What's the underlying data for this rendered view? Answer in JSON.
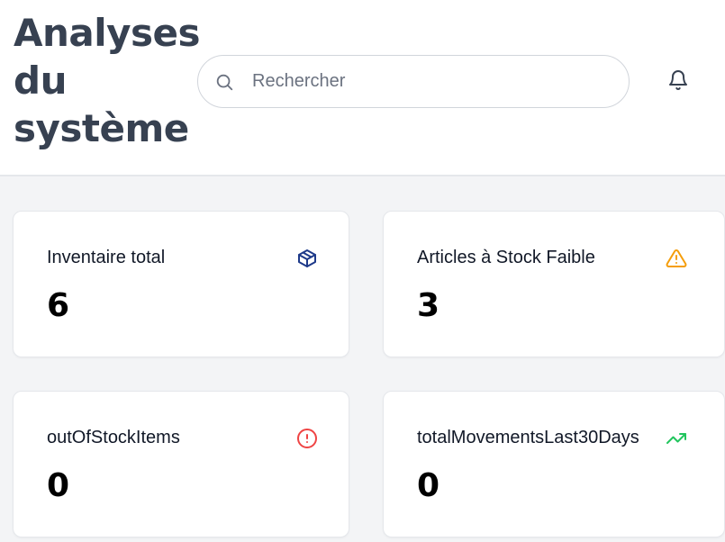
{
  "header": {
    "title_lines": [
      "Analyses",
      "du",
      "système"
    ],
    "search": {
      "placeholder": "Rechercher",
      "value": ""
    },
    "search_icon": "search-icon",
    "notification_icon": "bell-icon"
  },
  "cards": [
    {
      "label": "Inventaire total",
      "value": "6",
      "icon": "package-icon",
      "icon_color": "#1e3a8a"
    },
    {
      "label": "Articles à Stock Faible",
      "value": "3",
      "icon": "warning-icon",
      "icon_color": "#f59e0b"
    },
    {
      "label": "outOfStockItems",
      "value": "0",
      "icon": "alert-circle-icon",
      "icon_color": "#ef4444"
    },
    {
      "label": "totalMovementsLast30Days",
      "value": "0",
      "icon": "trending-up-icon",
      "icon_color": "#22c55e"
    }
  ],
  "colors": {
    "page_background": "#f3f4f6",
    "card_background": "#ffffff",
    "title": "#374151"
  }
}
